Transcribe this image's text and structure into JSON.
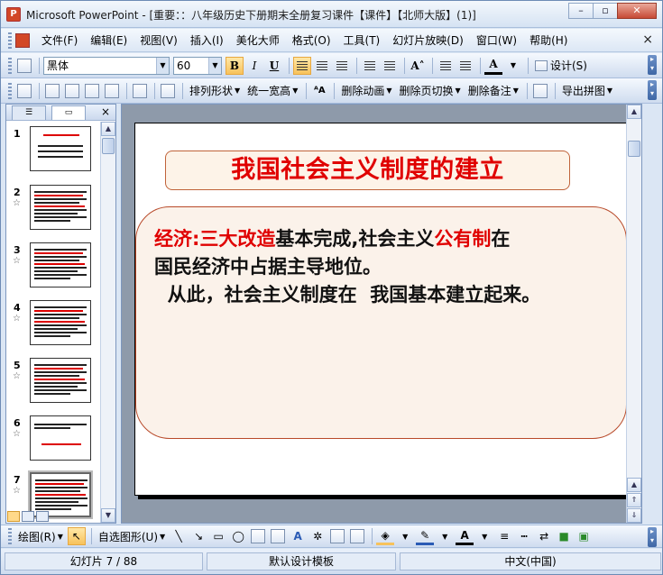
{
  "window": {
    "app_name": "Microsoft PowerPoint",
    "title": "Microsoft PowerPoint - [重要：：八年级历史下册期末全册复习课件【课件】【北师大版】(1)]",
    "controls": {
      "minimize": "–",
      "restore": "▫",
      "close": "✕"
    }
  },
  "menu": {
    "items": [
      "文件(F)",
      "编辑(E)",
      "视图(V)",
      "插入(I)",
      "美化大师",
      "格式(O)",
      "工具(T)",
      "幻灯片放映(D)",
      "窗口(W)",
      "帮助(H)"
    ],
    "close_glyph": "×"
  },
  "formatting_toolbar": {
    "font_name": "黑体",
    "font_size": "60",
    "bold": "B",
    "italic": "I",
    "underline": "U",
    "font_color_glyph": "A",
    "design_label": "设计(S)"
  },
  "custom_toolbar": {
    "arrange_shapes": "排列形状",
    "uniform_width_height": "统一宽高",
    "delete_animation": "删除动画",
    "delete_transition": "删除页切换",
    "delete_notes": "删除备注",
    "export_image": "导出拼图"
  },
  "slide_panel": {
    "close_glyph": "×",
    "thumbnails": [
      {
        "number": "1",
        "has_star": false
      },
      {
        "number": "2",
        "has_star": true
      },
      {
        "number": "3",
        "has_star": true
      },
      {
        "number": "4",
        "has_star": true
      },
      {
        "number": "5",
        "has_star": true
      },
      {
        "number": "6",
        "has_star": true
      },
      {
        "number": "7",
        "has_star": true
      }
    ],
    "star_glyph": "☆"
  },
  "slide": {
    "title": "我国社会主义制度的建立",
    "body": {
      "line1_red1": "经济:三大改造",
      "line1_black1": "基本完成,社会主义",
      "line1_red2": "公有制",
      "line1_black2": "在",
      "line2": "国民经济中占据主导地位。",
      "line3": "  从此，社会主义制度在  我国基本建立起来。"
    }
  },
  "drawing_toolbar": {
    "draw_label": "绘图(R)",
    "autoshapes_label": "自选图形(U)"
  },
  "status": {
    "slide_position": "幻灯片 7 / 88",
    "template": "默认设计模板",
    "language": "中文(中国)"
  },
  "colors": {
    "title_red": "#e00000",
    "frame_blue": "#c5d6ee",
    "highlight_orange": "#f7c25c"
  }
}
